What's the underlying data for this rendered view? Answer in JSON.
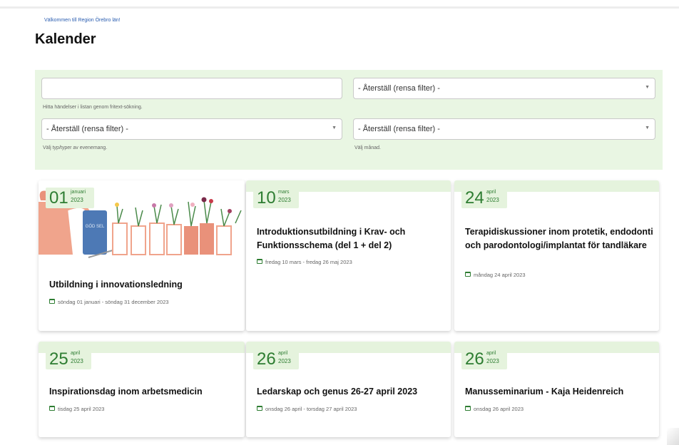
{
  "header": {
    "welcome": "Välkommen till Region Örebro län!",
    "title": "Kalender"
  },
  "filters": {
    "search": {
      "value": "",
      "hint": "Hitta händelser i listan genom fritext-sökning."
    },
    "select_top_right": {
      "value": "- Återställ (rensa filter) -"
    },
    "type": {
      "value": "- Återställ (rensa filter) -",
      "hint": "Välj typ/typer av evenemang."
    },
    "month": {
      "value": "- Återställ (rensa filter) -",
      "hint": "Välj månad."
    }
  },
  "events": [
    {
      "day": "01",
      "month": "januari",
      "year": "2023",
      "title": "Utbildning i innovationsledning",
      "dates": "söndag 01 januari - söndag 31 december 2023",
      "image_text": "GÖD SEL"
    },
    {
      "day": "10",
      "month": "mars",
      "year": "2023",
      "title": "Introduktionsutbildning i Krav- och Funktionsschema (del 1 + del 2)",
      "dates": "fredag 10 mars - fredag 26 maj 2023"
    },
    {
      "day": "24",
      "month": "april",
      "year": "2023",
      "title": "Terapidiskussioner inom protetik, endodonti och parodontologi/implantat för tandläkare",
      "dates": "måndag 24 april 2023"
    },
    {
      "day": "25",
      "month": "april",
      "year": "2023",
      "title": "Inspirationsdag inom arbetsmedicin",
      "dates": "tisdag 25 april 2023"
    },
    {
      "day": "26",
      "month": "april",
      "year": "2023",
      "title": "Ledarskap och genus 26-27 april 2023",
      "dates": "onsdag 26 april - torsdag 27 april 2023"
    },
    {
      "day": "26",
      "month": "april",
      "year": "2023",
      "title": "Manusseminarium - Kaja Heidenreich",
      "dates": "onsdag 26 april 2023"
    }
  ],
  "colors": {
    "accent": "#2e7d32",
    "filter_bg": "#e9f6e3",
    "card_band": "#e5f3dd",
    "link": "#2a5db0"
  },
  "icons": {
    "calendar": "calendar-icon",
    "dropdown": "chevron-down-icon"
  }
}
